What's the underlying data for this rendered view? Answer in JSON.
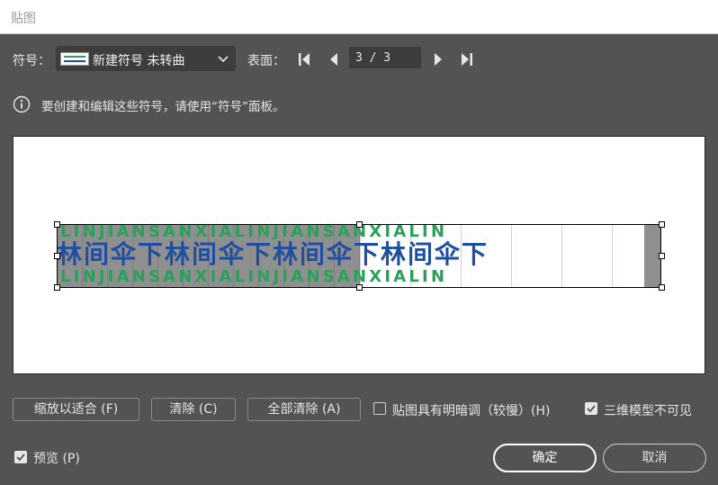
{
  "window": {
    "title": "贴图"
  },
  "symbol_row": {
    "label": "符号：",
    "selected_symbol": "新建符号 未转曲",
    "surface_label": "表面：",
    "page_value": "3 / 3"
  },
  "info": {
    "text": "要创建和编辑这些符号，请使用“符号”面板。"
  },
  "artwork": {
    "pinyin": "LINJIANSANXIALINJIANSANXIALIN",
    "hanzi": "林间伞下林间伞下林间伞下林间伞下",
    "colors": {
      "pinyin": "#2aa05a",
      "hanzi": "#1f4fa3"
    }
  },
  "buttons": {
    "fit": "缩放以适合 (F)",
    "clear": "清除 (C)",
    "clear_all": "全部清除 (A)",
    "ok": "确定",
    "cancel": "取消"
  },
  "options": {
    "shading_label": "贴图具有明暗调（较慢）(H)",
    "shading_checked": false,
    "hide_3d_label": "三维模型不可见",
    "hide_3d_checked": true,
    "preview_label": "预览 (P)",
    "preview_checked": true
  }
}
